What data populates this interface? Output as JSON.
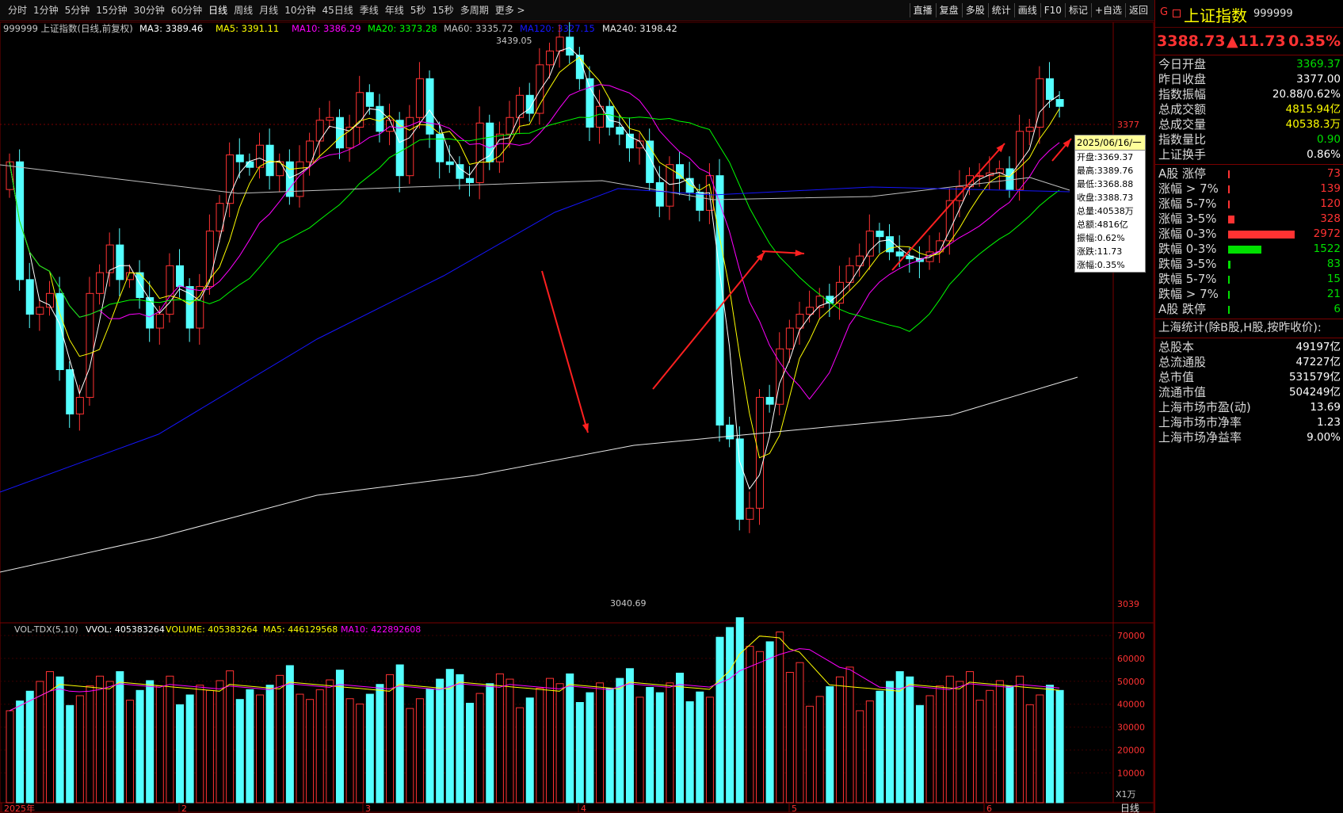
{
  "toolbar": {
    "tabs": [
      "分时",
      "1分钟",
      "5分钟",
      "15分钟",
      "30分钟",
      "60分钟",
      "日线",
      "周线",
      "月线",
      "10分钟",
      "45日线",
      "季线",
      "年线",
      "5秒",
      "15秒",
      "多周期",
      "更多 >"
    ],
    "active": "日线",
    "right": [
      "直播",
      "复盘",
      "多股",
      "统计",
      "画线",
      "F10",
      "标记",
      "+自选",
      "返回"
    ]
  },
  "main": {
    "legend": {
      "code": "999999 上证指数(日线,前复权)",
      "ma3": "MA3: 3389.46",
      "ma5": "MA5: 3391.11",
      "ma10": "MA10: 3386.29",
      "ma20": "MA20: 3373.28",
      "ma60": "MA60: 3335.72",
      "ma120": "MA120: 3327.15",
      "ma240": "MA240: 3198.42"
    },
    "high_label": "3439.05",
    "low_label": "3040.69",
    "axis_top": "3377",
    "axis_bottom": "3039",
    "vol_legend": {
      "name": "VOL-TDX(5,10)",
      "vvol": "VVOL: 405383264",
      "volume": "VOLUME: 405383264",
      "ma5": "MA5: 446129568",
      "ma10": "MA10: 422892608"
    },
    "vol_ticks": [
      "70000",
      "60000",
      "50000",
      "40000",
      "30000",
      "20000",
      "10000"
    ],
    "vol_unit": "X1万",
    "x_labels": [
      "2025年",
      "2",
      "3",
      "4",
      "5",
      "6"
    ],
    "period_label": "日线",
    "colors": {
      "up": "#ff3232",
      "down": "#54ffff",
      "ma3": "#ffffff",
      "ma5": "#ffff00",
      "ma10": "#ff00ff",
      "ma20": "#00ff00",
      "ma60": "#c0c0c0",
      "ma120": "#1515ff",
      "ma240": "#e8e8e8"
    }
  },
  "tooltip": {
    "date": "2025/06/16/一",
    "rows": [
      "开盘:3369.37",
      "最高:3389.76",
      "最低:3368.88",
      "收盘:3388.73",
      "总量:40538万",
      "总额:4816亿",
      "振幅:0.62%",
      "涨跌:11.73",
      "涨幅:0.35%"
    ]
  },
  "panel": {
    "g_label": "G",
    "g_icon": "grid-icon",
    "name": "上证指数",
    "code": "999999",
    "price": "3388.73",
    "change": "▲11.73",
    "pct": "0.35%",
    "stats": [
      {
        "k": "今日开盘",
        "v": "3369.37",
        "c": "#00e000"
      },
      {
        "k": "昨日收盘",
        "v": "3377.00",
        "c": "#ffffff"
      },
      {
        "k": "指数振幅",
        "v": "20.88/0.62%",
        "c": "#ffffff"
      },
      {
        "k": "总成交额",
        "v": "4815.94亿",
        "c": "#ffff00"
      },
      {
        "k": "总成交量",
        "v": "40538.3万",
        "c": "#ffff00"
      },
      {
        "k": "指数量比",
        "v": "0.90",
        "c": "#00e000"
      },
      {
        "k": "上证换手",
        "v": "0.86%",
        "c": "#ffffff"
      }
    ],
    "breadth": [
      {
        "k": "A股 涨停",
        "v": "73",
        "c": "#ff3232",
        "frac": 0.005
      },
      {
        "k": "涨幅 > 7%",
        "v": "139",
        "c": "#ff3232",
        "frac": 0.01
      },
      {
        "k": "涨幅 5-7%",
        "v": "120",
        "c": "#ff3232",
        "frac": 0.01
      },
      {
        "k": "涨幅 3-5%",
        "v": "328",
        "c": "#ff3232",
        "frac": 0.1
      },
      {
        "k": "涨幅 0-3%",
        "v": "2972",
        "c": "#ff3232",
        "frac": 1.0
      },
      {
        "k": "跌幅 0-3%",
        "v": "1522",
        "c": "#00e000",
        "frac": 0.5
      },
      {
        "k": "跌幅 3-5%",
        "v": "83",
        "c": "#00e000",
        "frac": 0.03
      },
      {
        "k": "跌幅 5-7%",
        "v": "15",
        "c": "#00e000",
        "frac": 0.005
      },
      {
        "k": "跌幅 > 7%",
        "v": "21",
        "c": "#00e000",
        "frac": 0.005
      },
      {
        "k": "A股 跌停",
        "v": "6",
        "c": "#00e000",
        "frac": 0.003
      }
    ],
    "sh_title": "上海统计(除B股,H股,按昨收价):",
    "sh": [
      {
        "k": "总股本",
        "v": "49197亿"
      },
      {
        "k": "总流通股",
        "v": "47227亿"
      },
      {
        "k": "总市值",
        "v": "531579亿"
      },
      {
        "k": "流通市值",
        "v": "504249亿"
      },
      {
        "k": "上海市场市盈(动)",
        "v": "13.69"
      },
      {
        "k": "上海市场市净率",
        "v": "1.23"
      },
      {
        "k": "上海市场净益率",
        "v": "9.00%"
      }
    ]
  }
}
